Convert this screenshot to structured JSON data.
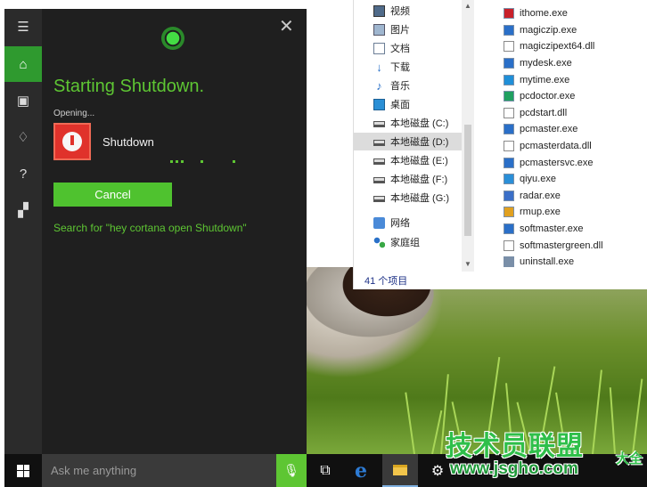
{
  "explorer": {
    "nav_items": [
      {
        "label": "视频",
        "icon": "video-icon"
      },
      {
        "label": "图片",
        "icon": "pictures-icon"
      },
      {
        "label": "文档",
        "icon": "documents-icon"
      },
      {
        "label": "下载",
        "icon": "downloads-icon"
      },
      {
        "label": "音乐",
        "icon": "music-icon"
      },
      {
        "label": "桌面",
        "icon": "desktop-icon"
      },
      {
        "label": "本地磁盘 (C:)",
        "icon": "drive-icon"
      },
      {
        "label": "本地磁盘 (D:)",
        "icon": "drive-icon",
        "selected": true
      },
      {
        "label": "本地磁盘 (E:)",
        "icon": "drive-icon"
      },
      {
        "label": "本地磁盘 (F:)",
        "icon": "drive-icon"
      },
      {
        "label": "本地磁盘 (G:)",
        "icon": "drive-icon"
      },
      {
        "label": "网络",
        "icon": "network-icon"
      },
      {
        "label": "家庭组",
        "icon": "homegroup-icon"
      }
    ],
    "files": [
      "ithome.exe",
      "magiczip.exe",
      "magiczipext64.dll",
      "mydesk.exe",
      "mytime.exe",
      "pcdoctor.exe",
      "pcdstart.dll",
      "pcmaster.exe",
      "pcmasterdata.dll",
      "pcmastersvc.exe",
      "qiyu.exe",
      "radar.exe",
      "rmup.exe",
      "softmaster.exe",
      "softmastergreen.dll",
      "uninstall.exe"
    ],
    "file_icon_colors": [
      "#c8202a",
      "#2a6fc8",
      "#888888",
      "#2a6fc8",
      "#1f8fd8",
      "#20a060",
      "#888888",
      "#2a6fc8",
      "#888888",
      "#2a6fc8",
      "#2a8fd8",
      "#3a6fc8",
      "#e0a020",
      "#2a6fc8",
      "#888888",
      "#7a8fa8"
    ],
    "status": "41 个项目"
  },
  "cortana": {
    "heading": "Starting Shutdown.",
    "opening": "Opening...",
    "app_name": "Shutdown",
    "cancel_label": "Cancel",
    "search_suggestion": "Search for \"hey cortana open Shutdown\"",
    "accent_color": "#5ec633"
  },
  "taskbar": {
    "search_placeholder": "Ask me anything"
  },
  "watermark": {
    "title": "技术员联盟",
    "side": "大全",
    "url": "www.jsgho.com"
  }
}
